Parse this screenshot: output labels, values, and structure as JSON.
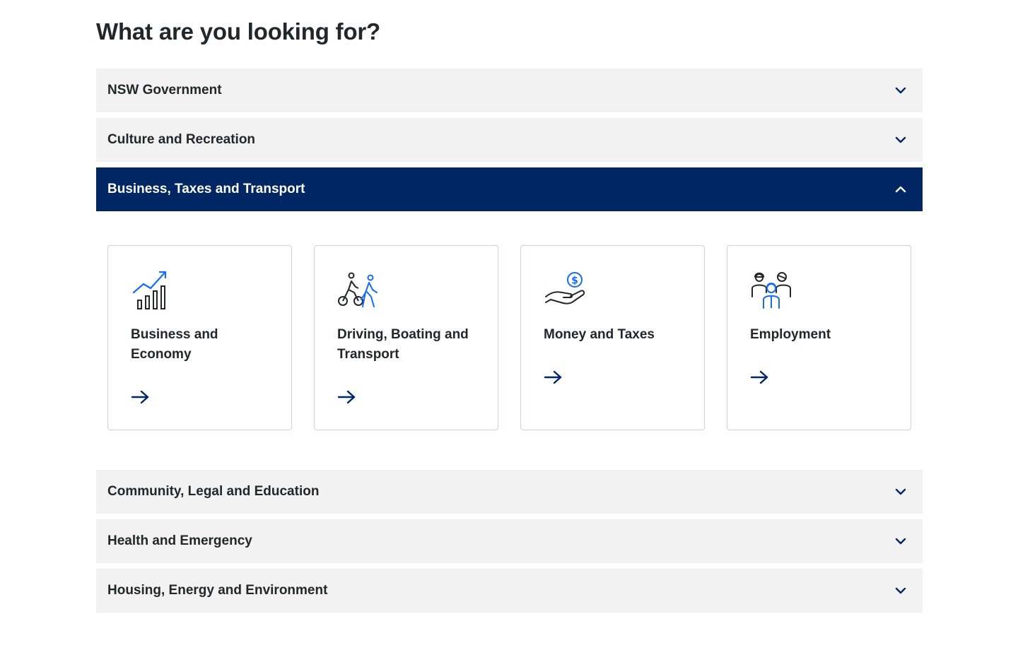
{
  "page": {
    "title": "What are you looking for?"
  },
  "colors": {
    "primary": "#002664",
    "accent": "#2e5299",
    "icon_blue": "#146cfd",
    "panel_bg": "#f2f2f2",
    "text": "#22272b"
  },
  "accordion": {
    "items": [
      {
        "label": "NSW Government",
        "expanded": false,
        "icon": "chevron-down-icon"
      },
      {
        "label": "Culture and Recreation",
        "expanded": false,
        "icon": "chevron-down-icon"
      },
      {
        "label": "Business, Taxes and Transport",
        "expanded": true,
        "icon": "chevron-up-icon"
      },
      {
        "label": "Community, Legal and Education",
        "expanded": false,
        "icon": "chevron-down-icon"
      },
      {
        "label": "Health and Emergency",
        "expanded": false,
        "icon": "chevron-down-icon"
      },
      {
        "label": "Housing, Energy and Environment",
        "expanded": false,
        "icon": "chevron-down-icon"
      }
    ]
  },
  "cards": [
    {
      "title": "Business and Economy",
      "icon": "growth-chart-icon",
      "arrow": "arrow-right-icon"
    },
    {
      "title": "Driving, Boating and Transport",
      "icon": "cyclist-pedestrian-icon",
      "arrow": "arrow-right-icon"
    },
    {
      "title": "Money and Taxes",
      "icon": "hand-coin-icon",
      "arrow": "arrow-right-icon"
    },
    {
      "title": "Employment",
      "icon": "workers-group-icon",
      "arrow": "arrow-right-icon"
    }
  ]
}
